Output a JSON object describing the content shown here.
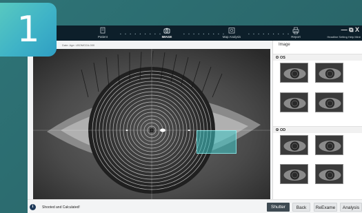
{
  "step_badge": "1",
  "nav": {
    "patient": "Patient",
    "image": "IMAGE",
    "map_analysis": "Map Analysis",
    "report": "Report",
    "win_controls": "— ⧉ X",
    "win_links": "Headline  Setting  Help  Minir"
  },
  "subbar_text": "Date: Age: LBOMO2A-000",
  "right_panel": {
    "title": "Image",
    "os_label": "OS",
    "od_label": "OD"
  },
  "status": {
    "icon": "info-icon",
    "text": "Shooted and Calculated!"
  },
  "buttons": {
    "shutter": "Shutter",
    "back": "Back",
    "reexame": "ReExame",
    "analysis": "Analysis"
  }
}
